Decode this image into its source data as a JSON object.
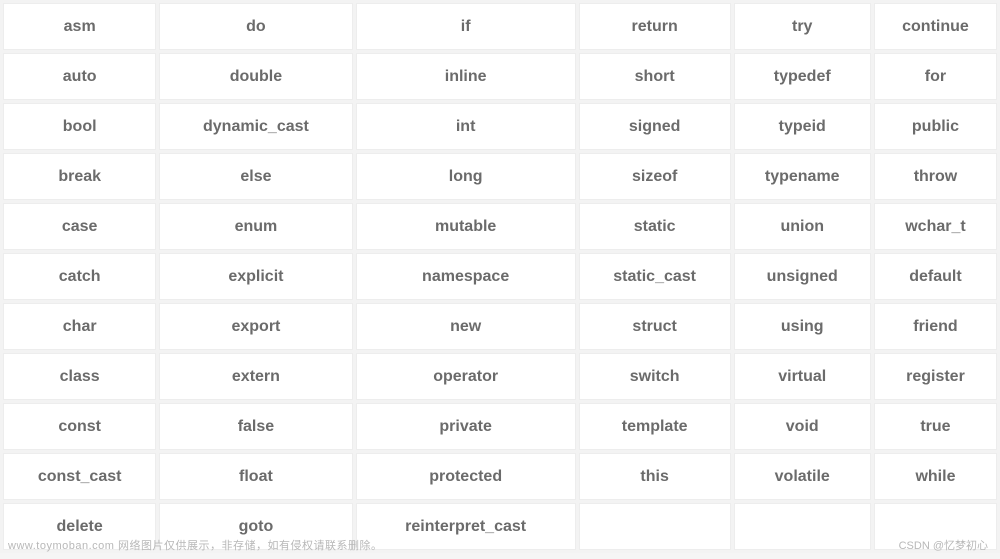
{
  "table": {
    "rows": [
      [
        "asm",
        "do",
        "if",
        "return",
        "try",
        "continue"
      ],
      [
        "auto",
        "double",
        "inline",
        "short",
        "typedef",
        "for"
      ],
      [
        "bool",
        "dynamic_cast",
        "int",
        "signed",
        "typeid",
        "public"
      ],
      [
        "break",
        "else",
        "long",
        "sizeof",
        "typename",
        "throw"
      ],
      [
        "case",
        "enum",
        "mutable",
        "static",
        "union",
        "wchar_t"
      ],
      [
        "catch",
        "explicit",
        "namespace",
        "static_cast",
        "unsigned",
        "default"
      ],
      [
        "char",
        "export",
        "new",
        "struct",
        "using",
        "friend"
      ],
      [
        "class",
        "extern",
        "operator",
        "switch",
        "virtual",
        "register"
      ],
      [
        "const",
        "false",
        "private",
        "template",
        "void",
        "true"
      ],
      [
        "const_cast",
        "float",
        "protected",
        "this",
        "volatile",
        "while"
      ],
      [
        "delete",
        "goto",
        "reinterpret_cast",
        "",
        "",
        ""
      ]
    ]
  },
  "footer": {
    "left": "www.toymoban.com 网络图片仅供展示，非存储，如有侵权请联系删除。",
    "right": "CSDN @忆梦初心"
  }
}
